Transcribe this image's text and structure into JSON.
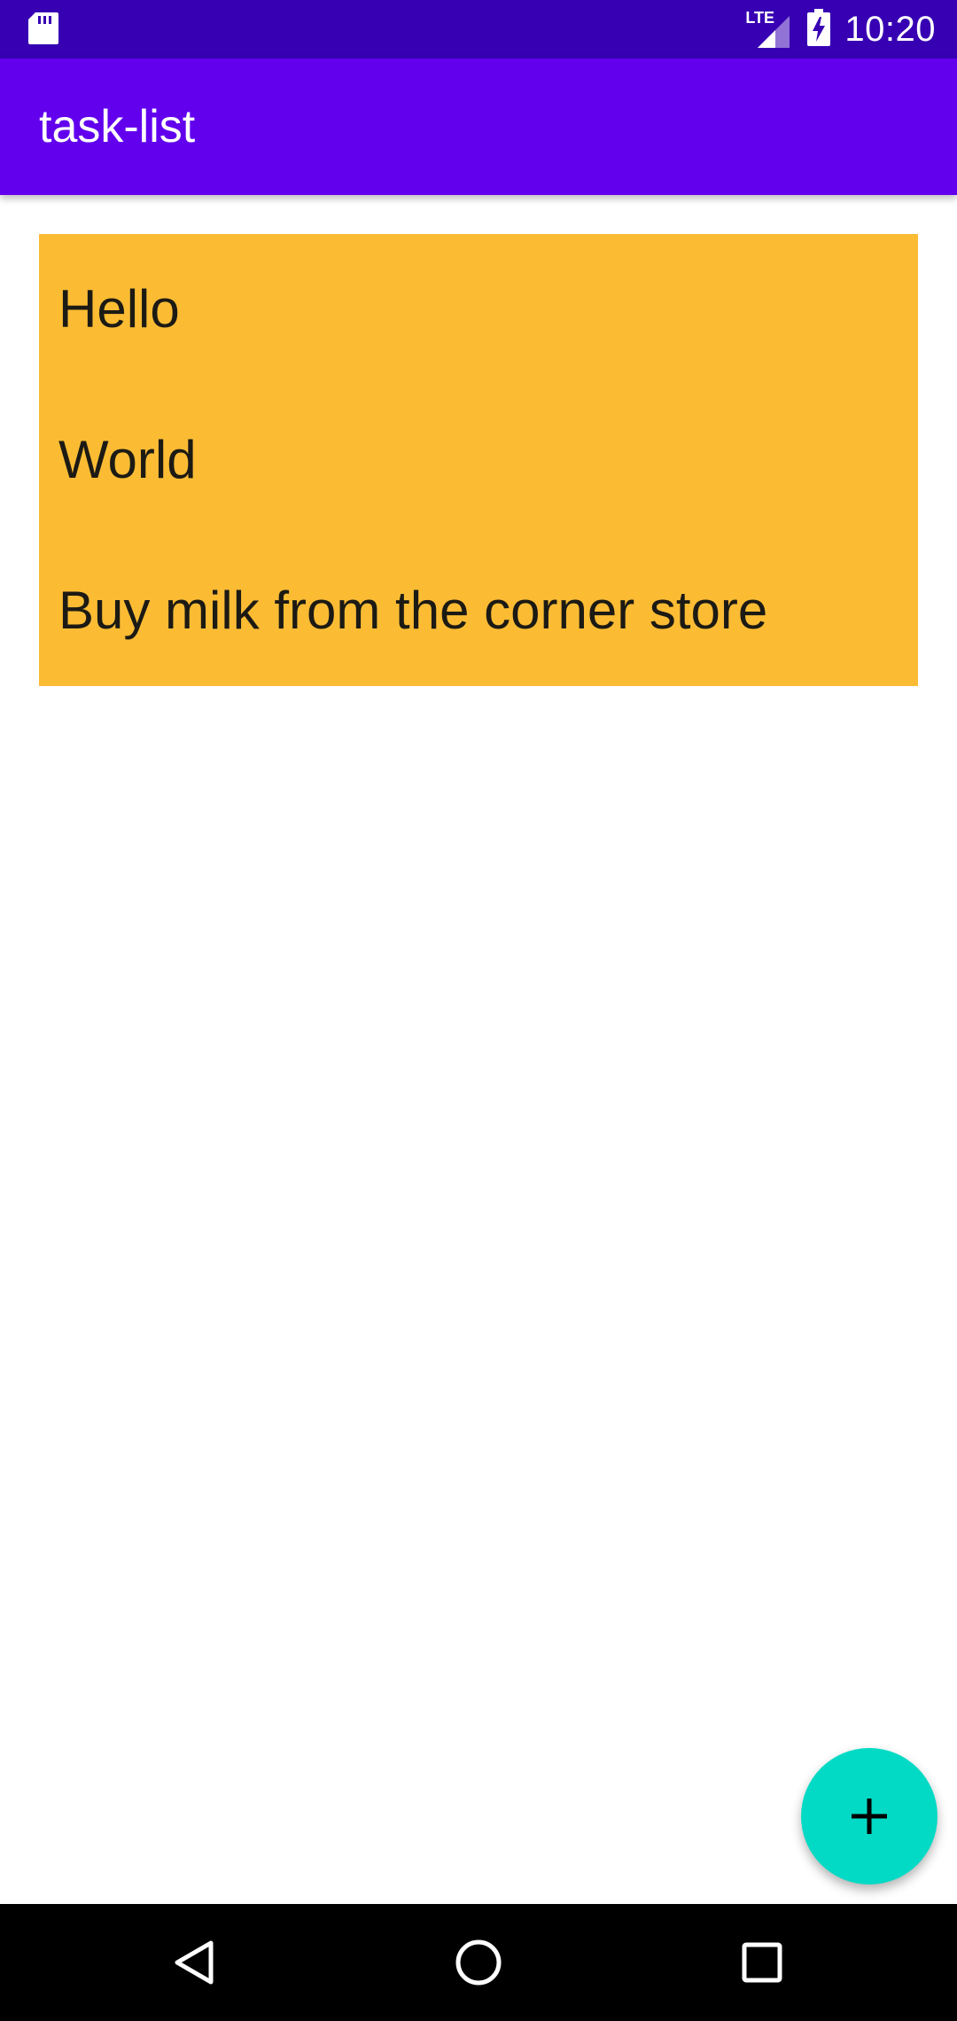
{
  "status_bar": {
    "time": "10:20",
    "network_label": "LTE",
    "icons": [
      "sd-card-icon",
      "lte-signal-icon",
      "battery-charging-icon"
    ]
  },
  "app_bar": {
    "title": "task-list"
  },
  "task_list": {
    "items": [
      {
        "text": "Hello"
      },
      {
        "text": "World"
      },
      {
        "text": "Buy milk from the corner store"
      }
    ]
  },
  "fab": {
    "icon": "plus-icon"
  },
  "nav_bar": {
    "icons": [
      "back-icon",
      "home-icon",
      "recents-icon"
    ]
  },
  "colors": {
    "status_bar": "#3700b3",
    "app_bar": "#6200ee",
    "card": "#fbbc34",
    "fab": "#03dac5",
    "nav_bar": "#000000"
  }
}
